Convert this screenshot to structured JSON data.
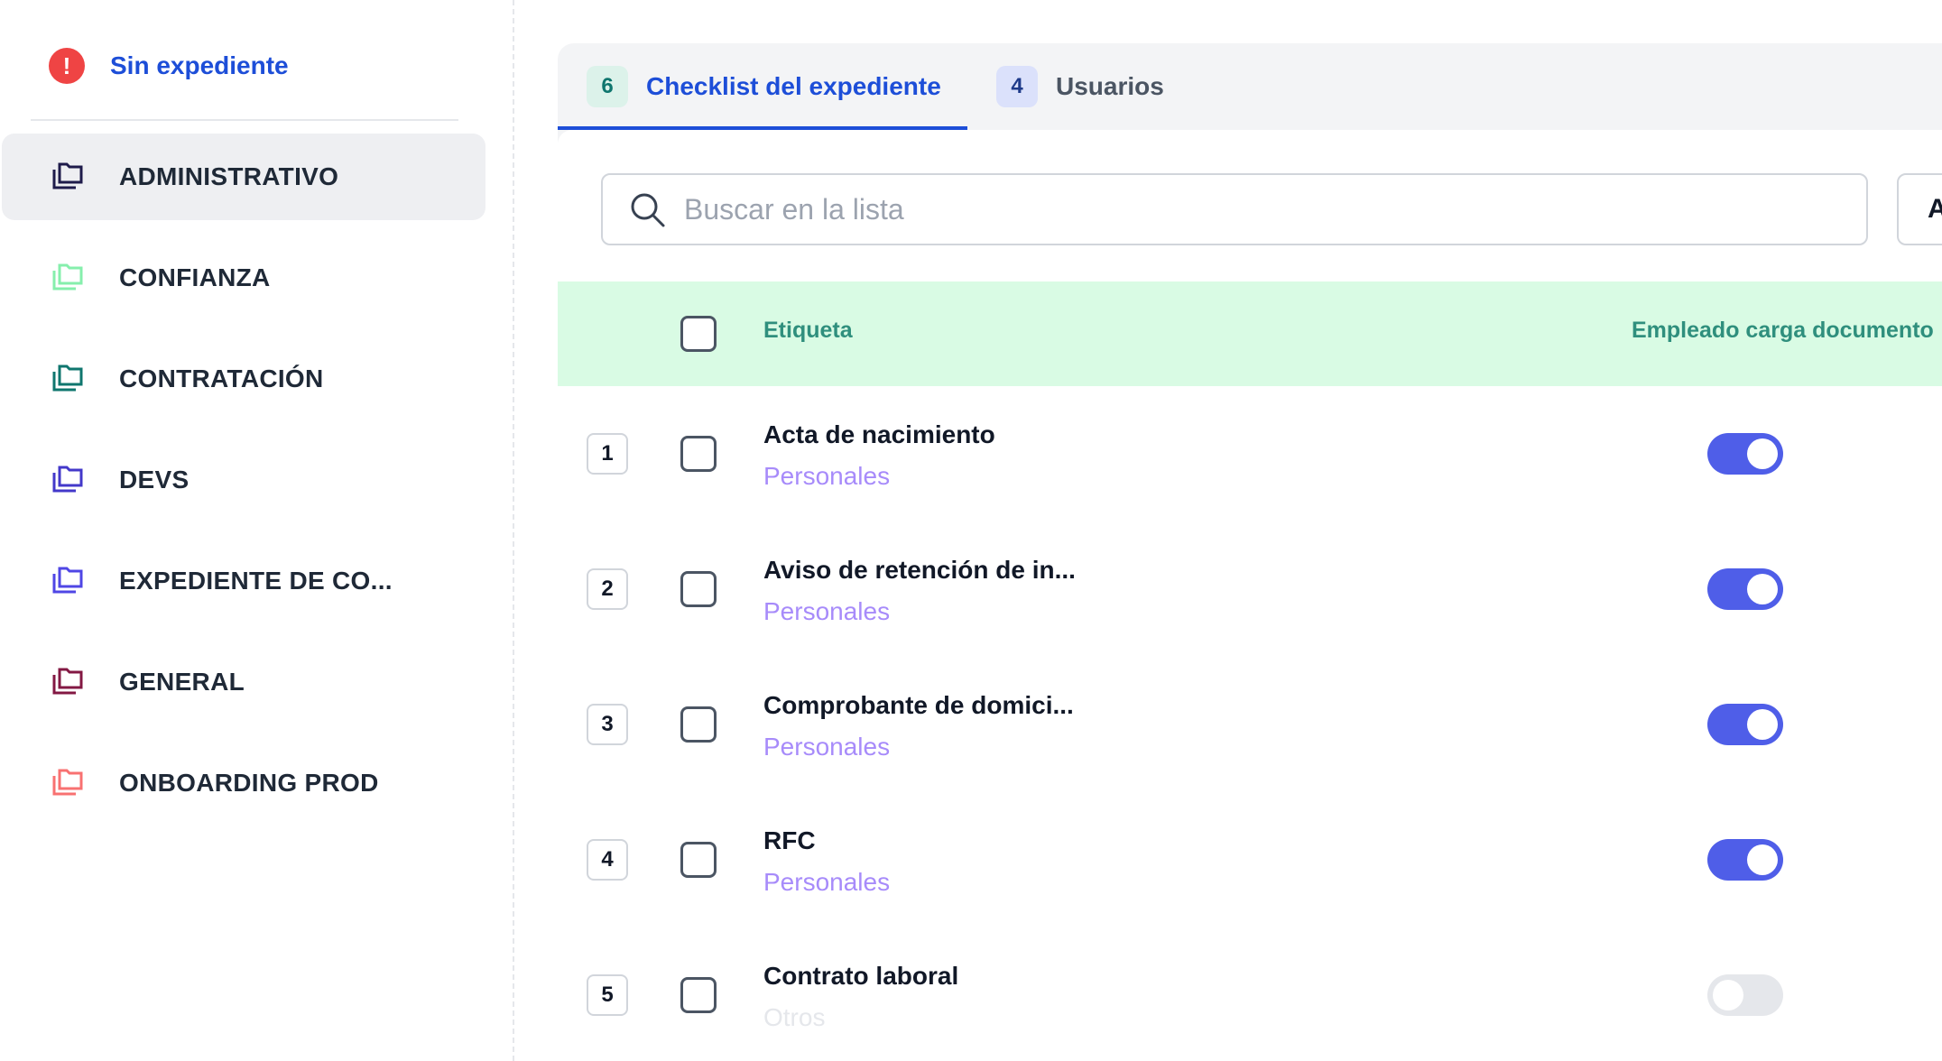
{
  "sidebar": {
    "no_file_label": "Sin expediente",
    "no_file_icon": "alert-circle-icon",
    "items": [
      {
        "label": "ADMINISTRATIVO",
        "color": "#1e1b4b",
        "icon": "folders-icon",
        "active": true
      },
      {
        "label": "CONFIANZA",
        "color": "#86efac",
        "icon": "folders-icon",
        "active": false
      },
      {
        "label": "CONTRATACIÓN",
        "color": "#0f766e",
        "icon": "folders-icon",
        "active": false
      },
      {
        "label": "DEVS",
        "color": "#4338ca",
        "icon": "folders-icon",
        "active": false
      },
      {
        "label": "EXPEDIENTE DE CO...",
        "color": "#4f46e5",
        "icon": "folders-icon",
        "active": false
      },
      {
        "label": "GENERAL",
        "color": "#831843",
        "icon": "folders-icon",
        "active": false
      },
      {
        "label": "ONBOARDING PROD",
        "color": "#f87171",
        "icon": "folders-icon",
        "active": false
      }
    ]
  },
  "tabs": [
    {
      "count": "6",
      "label": "Checklist del expediente",
      "active": true
    },
    {
      "count": "4",
      "label": "Usuarios",
      "active": false
    }
  ],
  "search": {
    "placeholder": "Buscar en la lista",
    "value": ""
  },
  "side_button": {
    "label": "A"
  },
  "table": {
    "headers": {
      "label": "Etiqueta",
      "employee_upload": "Empleado carga documento"
    },
    "rows": [
      {
        "num": "1",
        "title": "Acta de nacimiento",
        "category": "Personales",
        "employee_upload": true
      },
      {
        "num": "2",
        "title": "Aviso de retención de in...",
        "category": "Personales",
        "employee_upload": true
      },
      {
        "num": "3",
        "title": "Comprobante de domici...",
        "category": "Personales",
        "employee_upload": true
      },
      {
        "num": "4",
        "title": "RFC",
        "category": "Personales",
        "employee_upload": true
      },
      {
        "num": "5",
        "title": "Contrato laboral",
        "category": "Otros",
        "employee_upload": false
      }
    ]
  },
  "colors": {
    "accent": "#1d4ed8",
    "toggle_on": "#4f5ee8",
    "header_bg": "#d9fbe4",
    "category_text": "#a78bfa"
  }
}
